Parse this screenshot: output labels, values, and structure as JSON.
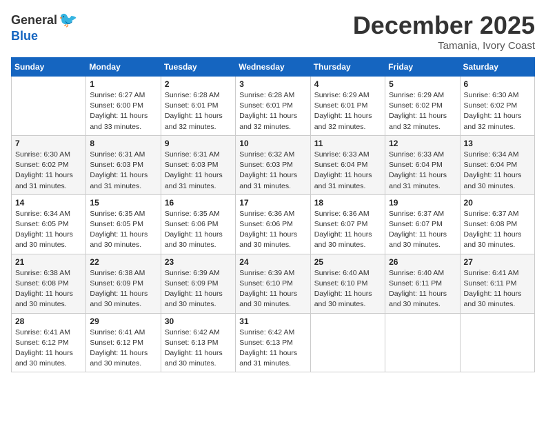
{
  "header": {
    "logo_general": "General",
    "logo_blue": "Blue",
    "month": "December 2025",
    "location": "Tamania, Ivory Coast"
  },
  "weekdays": [
    "Sunday",
    "Monday",
    "Tuesday",
    "Wednesday",
    "Thursday",
    "Friday",
    "Saturday"
  ],
  "weeks": [
    [
      {
        "day": "",
        "info": ""
      },
      {
        "day": "1",
        "info": "Sunrise: 6:27 AM\nSunset: 6:00 PM\nDaylight: 11 hours and 33 minutes."
      },
      {
        "day": "2",
        "info": "Sunrise: 6:28 AM\nSunset: 6:01 PM\nDaylight: 11 hours and 32 minutes."
      },
      {
        "day": "3",
        "info": "Sunrise: 6:28 AM\nSunset: 6:01 PM\nDaylight: 11 hours and 32 minutes."
      },
      {
        "day": "4",
        "info": "Sunrise: 6:29 AM\nSunset: 6:01 PM\nDaylight: 11 hours and 32 minutes."
      },
      {
        "day": "5",
        "info": "Sunrise: 6:29 AM\nSunset: 6:02 PM\nDaylight: 11 hours and 32 minutes."
      },
      {
        "day": "6",
        "info": "Sunrise: 6:30 AM\nSunset: 6:02 PM\nDaylight: 11 hours and 32 minutes."
      }
    ],
    [
      {
        "day": "7",
        "info": "Sunrise: 6:30 AM\nSunset: 6:02 PM\nDaylight: 11 hours and 31 minutes."
      },
      {
        "day": "8",
        "info": "Sunrise: 6:31 AM\nSunset: 6:03 PM\nDaylight: 11 hours and 31 minutes."
      },
      {
        "day": "9",
        "info": "Sunrise: 6:31 AM\nSunset: 6:03 PM\nDaylight: 11 hours and 31 minutes."
      },
      {
        "day": "10",
        "info": "Sunrise: 6:32 AM\nSunset: 6:03 PM\nDaylight: 11 hours and 31 minutes."
      },
      {
        "day": "11",
        "info": "Sunrise: 6:33 AM\nSunset: 6:04 PM\nDaylight: 11 hours and 31 minutes."
      },
      {
        "day": "12",
        "info": "Sunrise: 6:33 AM\nSunset: 6:04 PM\nDaylight: 11 hours and 31 minutes."
      },
      {
        "day": "13",
        "info": "Sunrise: 6:34 AM\nSunset: 6:04 PM\nDaylight: 11 hours and 30 minutes."
      }
    ],
    [
      {
        "day": "14",
        "info": "Sunrise: 6:34 AM\nSunset: 6:05 PM\nDaylight: 11 hours and 30 minutes."
      },
      {
        "day": "15",
        "info": "Sunrise: 6:35 AM\nSunset: 6:05 PM\nDaylight: 11 hours and 30 minutes."
      },
      {
        "day": "16",
        "info": "Sunrise: 6:35 AM\nSunset: 6:06 PM\nDaylight: 11 hours and 30 minutes."
      },
      {
        "day": "17",
        "info": "Sunrise: 6:36 AM\nSunset: 6:06 PM\nDaylight: 11 hours and 30 minutes."
      },
      {
        "day": "18",
        "info": "Sunrise: 6:36 AM\nSunset: 6:07 PM\nDaylight: 11 hours and 30 minutes."
      },
      {
        "day": "19",
        "info": "Sunrise: 6:37 AM\nSunset: 6:07 PM\nDaylight: 11 hours and 30 minutes."
      },
      {
        "day": "20",
        "info": "Sunrise: 6:37 AM\nSunset: 6:08 PM\nDaylight: 11 hours and 30 minutes."
      }
    ],
    [
      {
        "day": "21",
        "info": "Sunrise: 6:38 AM\nSunset: 6:08 PM\nDaylight: 11 hours and 30 minutes."
      },
      {
        "day": "22",
        "info": "Sunrise: 6:38 AM\nSunset: 6:09 PM\nDaylight: 11 hours and 30 minutes."
      },
      {
        "day": "23",
        "info": "Sunrise: 6:39 AM\nSunset: 6:09 PM\nDaylight: 11 hours and 30 minutes."
      },
      {
        "day": "24",
        "info": "Sunrise: 6:39 AM\nSunset: 6:10 PM\nDaylight: 11 hours and 30 minutes."
      },
      {
        "day": "25",
        "info": "Sunrise: 6:40 AM\nSunset: 6:10 PM\nDaylight: 11 hours and 30 minutes."
      },
      {
        "day": "26",
        "info": "Sunrise: 6:40 AM\nSunset: 6:11 PM\nDaylight: 11 hours and 30 minutes."
      },
      {
        "day": "27",
        "info": "Sunrise: 6:41 AM\nSunset: 6:11 PM\nDaylight: 11 hours and 30 minutes."
      }
    ],
    [
      {
        "day": "28",
        "info": "Sunrise: 6:41 AM\nSunset: 6:12 PM\nDaylight: 11 hours and 30 minutes."
      },
      {
        "day": "29",
        "info": "Sunrise: 6:41 AM\nSunset: 6:12 PM\nDaylight: 11 hours and 30 minutes."
      },
      {
        "day": "30",
        "info": "Sunrise: 6:42 AM\nSunset: 6:13 PM\nDaylight: 11 hours and 30 minutes."
      },
      {
        "day": "31",
        "info": "Sunrise: 6:42 AM\nSunset: 6:13 PM\nDaylight: 11 hours and 31 minutes."
      },
      {
        "day": "",
        "info": ""
      },
      {
        "day": "",
        "info": ""
      },
      {
        "day": "",
        "info": ""
      }
    ]
  ]
}
